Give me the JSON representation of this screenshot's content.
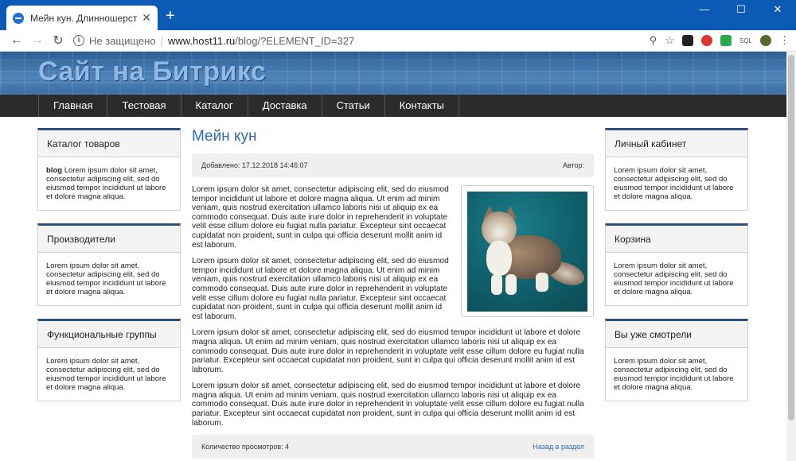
{
  "browser": {
    "tab_title": "Мейн кун. Длинношерстные. С",
    "tab_close": "✕",
    "new_tab": "+",
    "win_min": "—",
    "win_max": "☐",
    "win_close": "✕",
    "back": "←",
    "forward": "→",
    "reload": "↻",
    "not_secure": "Не защищено",
    "separator": "|",
    "url_host": "www.host11.ru",
    "url_path": "/blog/?ELEMENT_ID=327",
    "zoom_icon": "⚲",
    "star_icon": "☆",
    "menu_icon": "⋮",
    "ext_sql": "SQL"
  },
  "site": {
    "title": "Сайт на Битрикс",
    "menu": [
      "Главная",
      "Тестовая",
      "Каталог",
      "Доставка",
      "Статьи",
      "Контакты"
    ]
  },
  "left": [
    {
      "title": "Каталог товаров",
      "bold": "blog",
      "text": " Lorem ipsum dolor sit amet, consectetur adipiscing elit, sed do eiusmod tempor incididunt ut labore et dolore magna aliqua."
    },
    {
      "title": "Производители",
      "bold": "",
      "text": "Lorem ipsum dolor sit amet, consectetur adipiscing elit, sed do eiusmod tempor incididunt ut labore et dolore magna aliqua."
    },
    {
      "title": "Функциональные группы",
      "bold": "",
      "text": "Lorem ipsum dolor sit amet, consectetur adipiscing elit, sed do eiusmod tempor incididunt ut labore et dolore magna aliqua."
    }
  ],
  "right": [
    {
      "title": "Личный кабинет",
      "text": "Lorem ipsum dolor sit amet, consectetur adipiscing elit, sed do eiusmod tempor incididunt ut labore et dolore magna aliqua."
    },
    {
      "title": "Корзина",
      "text": "Lorem ipsum dolor sit amet, consectetur adipiscing elit, sed do eiusmod tempor incididunt ut labore et dolore magna aliqua."
    },
    {
      "title": "Вы уже смотрели",
      "text": "Lorem ipsum dolor sit amet, consectetur adipiscing elit, sed do eiusmod tempor incididunt ut labore et dolore magna aliqua."
    }
  ],
  "article": {
    "title": "Мейн кун",
    "added": "Добавлено: 17.12.2018 14:46:07",
    "author": "Автор:",
    "paragraphs": [
      "Lorem ipsum dolor sit amet, consectetur adipiscing elit, sed do eiusmod tempor incididunt ut labore et dolore magna aliqua. Ut enim ad minim veniam, quis nostrud exercitation ullamco laboris nisi ut aliquip ex ea commodo consequat. Duis aute irure dolor in reprehenderit in voluptate velit esse cillum dolore eu fugiat nulla pariatur. Excepteur sint occaecat cupidatat non proident, sunt in culpa qui officia deserunt mollit anim id est laborum.",
      "Lorem ipsum dolor sit amet, consectetur adipiscing elit, sed do eiusmod tempor incididunt ut labore et dolore magna aliqua. Ut enim ad minim veniam, quis nostrud exercitation ullamco laboris nisi ut aliquip ex ea commodo consequat. Duis aute irure dolor in reprehenderit in voluptate velit esse cillum dolore eu fugiat nulla pariatur. Excepteur sint occaecat cupidatat non proident, sunt in culpa qui officia deserunt mollit anim id est laborum.",
      "Lorem ipsum dolor sit amet, consectetur adipiscing elit, sed do eiusmod tempor incididunt ut labore et dolore magna aliqua. Ut enim ad minim veniam, quis nostrud exercitation ullamco laboris nisi ut aliquip ex ea commodo consequat. Duis aute irure dolor in reprehenderit in voluptate velit esse cillum dolore eu fugiat nulla pariatur. Excepteur sint occaecat cupidatat non proident, sunt in culpa qui officia deserunt mollit anim id est laborum.",
      "Lorem ipsum dolor sit amet, consectetur adipiscing elit, sed do eiusmod tempor incididunt ut labore et dolore magna aliqua. Ut enim ad minim veniam, quis nostrud exercitation ullamco laboris nisi ut aliquip ex ea commodo consequat. Duis aute irure dolor in reprehenderit in voluptate velit esse cillum dolore eu fugiat nulla pariatur. Excepteur sint occaecat cupidatat non proident, sunt in culpa qui officia deserunt mollit anim id est laborum."
    ],
    "views": "Количество просмотров: 4",
    "back_link": "Назад в раздел"
  },
  "colors": {
    "accent": "#2c6ab0",
    "chrome": "#0b5bb6",
    "menu_bg": "#2b2b2b",
    "box_border": "#2e4f7c"
  }
}
